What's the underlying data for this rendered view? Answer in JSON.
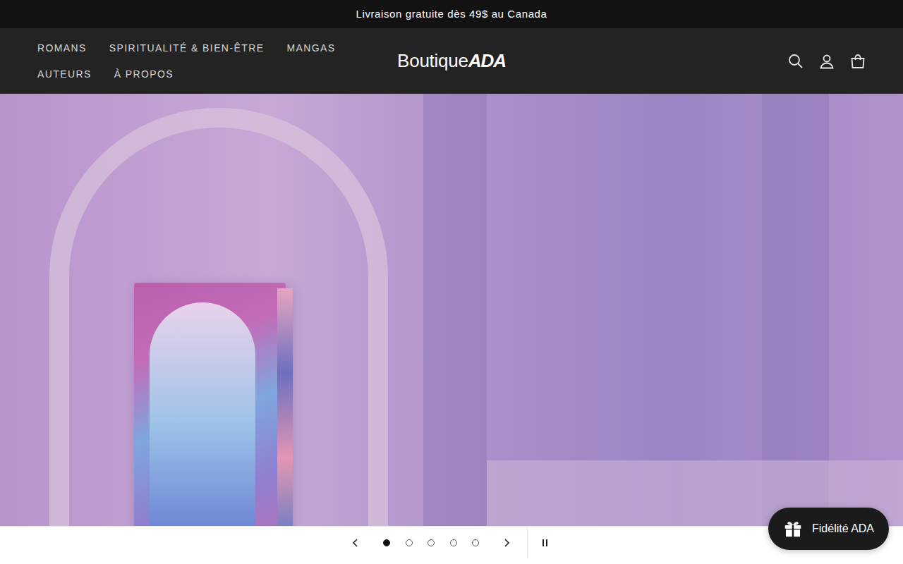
{
  "announcement": "Livraison gratuite dès 49$ au Canada",
  "nav": {
    "rows": [
      [
        "ROMANS",
        "SPIRITUALITÉ & BIEN-ÊTRE",
        "MANGAS"
      ],
      [
        "AUTEURS",
        "À PROPOS"
      ]
    ]
  },
  "logo": {
    "word": "Boutique",
    "mark": "ADA"
  },
  "slider": {
    "dots": [
      {
        "selected": true
      },
      {
        "selected": false
      },
      {
        "selected": false
      },
      {
        "selected": false
      },
      {
        "selected": false
      }
    ]
  },
  "loyalty": {
    "label": "Fidélité ADA"
  }
}
